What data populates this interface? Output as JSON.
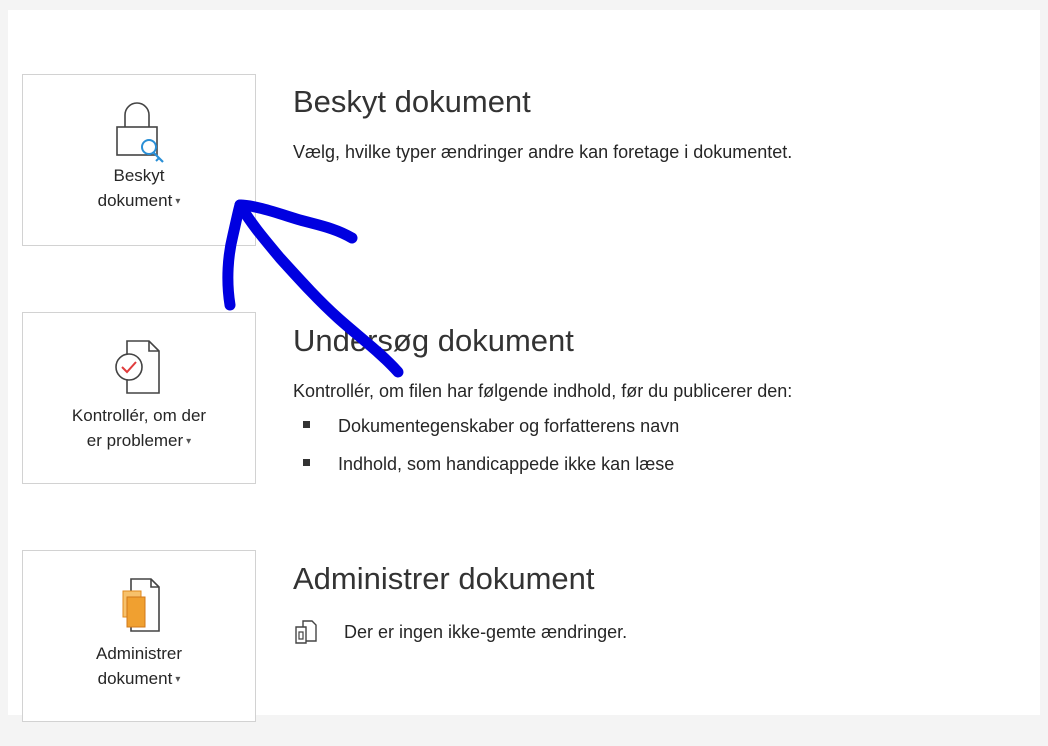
{
  "sections": [
    {
      "tile_label_line1": "Beskyt",
      "tile_label_line2": "dokument",
      "tile_icon": "lock-key-icon",
      "heading": "Beskyt dokument",
      "description": "Vælg, hvilke typer ændringer andre kan foretage i dokumentet."
    },
    {
      "tile_label_line1": "Kontrollér, om der",
      "tile_label_line2": "er problemer",
      "tile_icon": "document-check-icon",
      "heading": "Undersøg dokument",
      "description": "Kontrollér, om filen har følgende indhold, før du publicerer den:",
      "bullets": [
        "Dokumentegenskaber og forfatterens navn",
        "Indhold, som handicappede ikke kan læse"
      ]
    },
    {
      "tile_label_line1": "Administrer",
      "tile_label_line2": "dokument",
      "tile_icon": "manage-document-icon",
      "heading": "Administrer dokument",
      "status": "Der er ingen ikke-gemte ændringer.",
      "status_icon": "document-versions-icon"
    }
  ],
  "caret": "▾",
  "colors": {
    "annotation": "#0000e0",
    "accent_orange": "#f0a030",
    "check_red": "#e03c3c",
    "key_blue": "#2a8fd6"
  }
}
